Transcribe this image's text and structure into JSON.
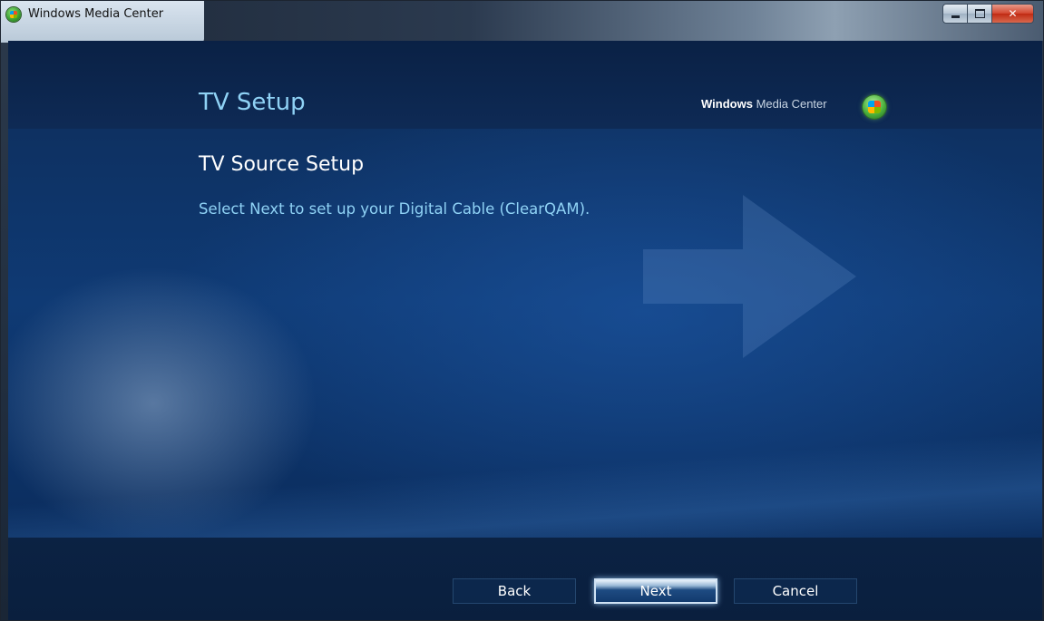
{
  "window": {
    "title": "Windows Media Center"
  },
  "header": {
    "title": "TV Setup",
    "brand_bold": "Windows",
    "brand_rest": "Media Center"
  },
  "main": {
    "heading": "TV Source Setup",
    "instruction": "Select Next to set up your Digital Cable (ClearQAM)."
  },
  "footer": {
    "back_label": "Back",
    "next_label": "Next",
    "cancel_label": "Cancel"
  },
  "colors": {
    "accent_text": "#8fd2f5",
    "background_blue": "#0f3a74"
  }
}
